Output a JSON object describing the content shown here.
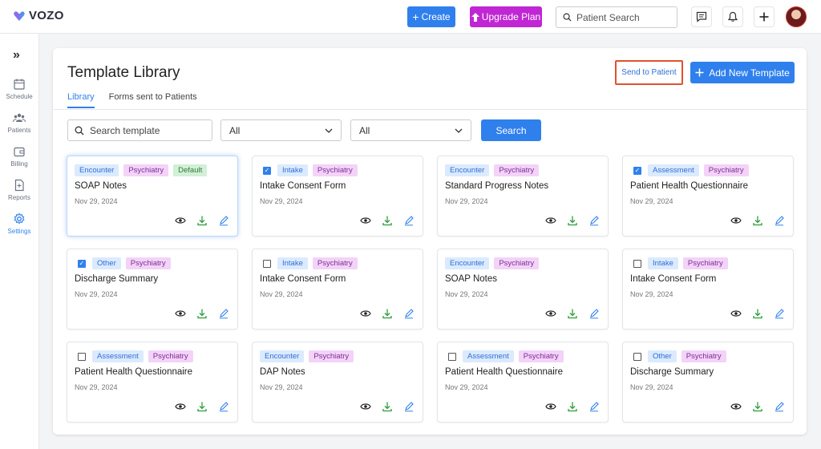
{
  "app": {
    "name": "VOZO"
  },
  "topbar": {
    "create_label": "Create",
    "upgrade_label": "Upgrade Plan",
    "search_placeholder": "Patient Search"
  },
  "sidebar": {
    "items": [
      {
        "label": "Schedule",
        "icon": "calendar-icon"
      },
      {
        "label": "Patients",
        "icon": "users-icon"
      },
      {
        "label": "Billing",
        "icon": "wallet-icon"
      },
      {
        "label": "Reports",
        "icon": "report-icon"
      },
      {
        "label": "Settings",
        "icon": "gear-icon",
        "active": true
      }
    ]
  },
  "page": {
    "title": "Template Library",
    "send_label": "Send to Patient",
    "add_label": "Add New Template",
    "tabs": [
      {
        "label": "Library",
        "active": true
      },
      {
        "label": "Forms sent to Patients",
        "active": false
      }
    ]
  },
  "filters": {
    "search_placeholder": "Search template",
    "select1": "All",
    "select2": "All",
    "search_button": "Search"
  },
  "colors": {
    "accent": "#2f80ed",
    "upgrade": "#c026d3",
    "highlight_border": "#e0522f"
  },
  "cards": [
    {
      "title": "SOAP Notes",
      "date": "Nov 29, 2024",
      "checkbox": null,
      "tags": [
        "Encounter",
        "Psychiatry",
        "Default"
      ]
    },
    {
      "title": "Intake Consent Form",
      "date": "Nov 29, 2024",
      "checkbox": true,
      "tags": [
        "Intake",
        "Psychiatry"
      ]
    },
    {
      "title": "Standard Progress Notes",
      "date": "Nov 29, 2024",
      "checkbox": null,
      "tags": [
        "Encounter",
        "Psychiatry"
      ]
    },
    {
      "title": "Patient Health Questionnaire",
      "date": "Nov 29, 2024",
      "checkbox": true,
      "tags": [
        "Assessment",
        "Psychiatry"
      ]
    },
    {
      "title": "Discharge Summary",
      "date": "Nov 29, 2024",
      "checkbox": true,
      "tags": [
        "Other",
        "Psychiatry"
      ]
    },
    {
      "title": "Intake Consent Form",
      "date": "Nov 29, 2024",
      "checkbox": false,
      "tags": [
        "Intake",
        "Psychiatry"
      ]
    },
    {
      "title": "SOAP Notes",
      "date": "Nov 29, 2024",
      "checkbox": null,
      "tags": [
        "Encounter",
        "Psychiatry"
      ]
    },
    {
      "title": "Intake Consent Form",
      "date": "Nov 29, 2024",
      "checkbox": false,
      "tags": [
        "Intake",
        "Psychiatry"
      ]
    },
    {
      "title": "Patient Health Questionnaire",
      "date": "Nov 29, 2024",
      "checkbox": false,
      "tags": [
        "Assessment",
        "Psychiatry"
      ]
    },
    {
      "title": "DAP Notes",
      "date": "Nov 29, 2024",
      "checkbox": null,
      "tags": [
        "Encounter",
        "Psychiatry"
      ]
    },
    {
      "title": "Patient Health Questionnaire",
      "date": "Nov 29, 2024",
      "checkbox": false,
      "tags": [
        "Assessment",
        "Psychiatry"
      ]
    },
    {
      "title": "Discharge Summary",
      "date": "Nov 29, 2024",
      "checkbox": false,
      "tags": [
        "Other",
        "Psychiatry"
      ]
    }
  ]
}
